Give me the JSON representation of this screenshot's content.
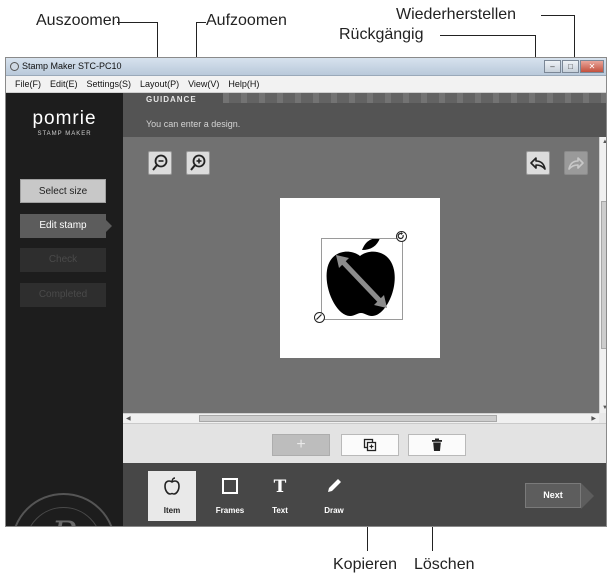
{
  "callouts": {
    "zoom_out": "Auszoomen",
    "zoom_in": "Aufzoomen",
    "redo": "Wiederherstellen",
    "undo": "Rückgängig",
    "copy": "Kopieren",
    "delete": "Löschen"
  },
  "window": {
    "title": "Stamp Maker STC-PC10",
    "controls": [
      "–",
      "□",
      "✕"
    ]
  },
  "menu": [
    "File(F)",
    "Edit(E)",
    "Settings(S)",
    "Layout(P)",
    "View(V)",
    "Help(H)"
  ],
  "brand": {
    "name": "pomrie",
    "sub": "STAMP MAKER",
    "seal_letter": "P"
  },
  "steps": [
    {
      "label": "Select size",
      "state": "done"
    },
    {
      "label": "Edit stamp",
      "state": "active"
    },
    {
      "label": "Check",
      "state": "off"
    },
    {
      "label": "Completed",
      "state": "off"
    }
  ],
  "guidance": {
    "label": "GUIDANCE",
    "message": "You can enter a design."
  },
  "design": {
    "item_icon": "apple-icon",
    "rotate_icon": "rotate-icon",
    "resize_icon": "resize-icon"
  },
  "actions": {
    "add": "+",
    "copy_icon": "copy-icon",
    "delete_icon": "trash-icon"
  },
  "tabs": [
    {
      "label": "Item",
      "icon": "apple-outline-icon",
      "selected": true
    },
    {
      "label": "Frames",
      "icon": "frame-icon",
      "selected": false
    },
    {
      "label": "Text",
      "icon": "text-icon",
      "selected": false
    },
    {
      "label": "Draw",
      "icon": "pen-icon",
      "selected": false
    }
  ],
  "next_label": "Next",
  "colors": {
    "left_panel": "#1d1d1d",
    "canvas_bg": "#717171",
    "guidance_bg": "#545454",
    "bottom_bar": "#474747"
  }
}
